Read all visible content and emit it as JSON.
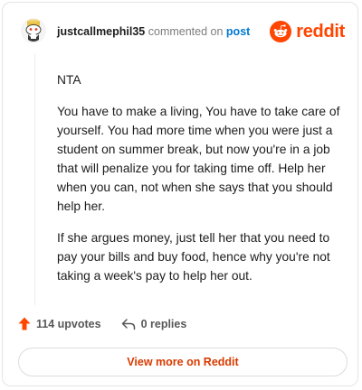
{
  "comment": {
    "username": "justcallmephil35",
    "action_text": "commented on",
    "post_link": "post",
    "paragraphs": [
      "NTA",
      "You have to make a living, You have to take care of yourself. You had more time when you were just a student on summer break, but now you're in a job that will penalize you for taking time off. Help her when you can, not when she says that you should help her.",
      "If she argues money, just tell her that you need to pay your bills and buy food, hence why you're not taking a week's pay to help her out."
    ]
  },
  "brand": {
    "name": "reddit",
    "color": "#ff4500"
  },
  "footer": {
    "upvotes": "114 upvotes",
    "replies": "0 replies"
  },
  "actions": {
    "view_more": "View more on Reddit"
  },
  "icons": {
    "avatar": "snoo-avatar",
    "logo": "reddit-alien-icon",
    "upvote": "upvote-arrow-icon",
    "reply": "reply-arrow-icon"
  }
}
